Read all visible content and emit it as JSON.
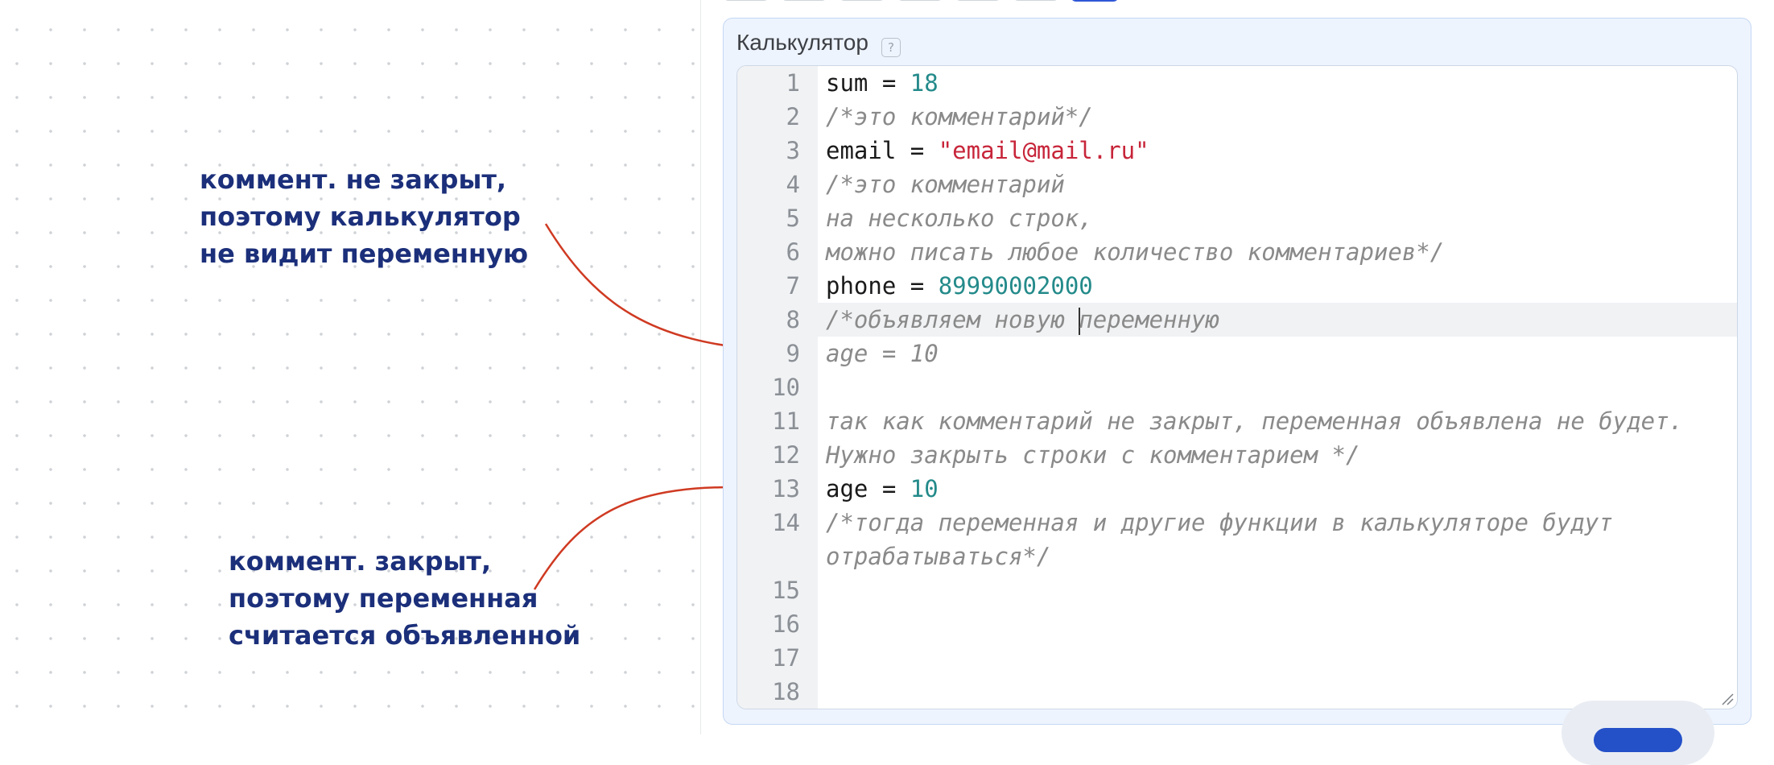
{
  "annotations": {
    "top": "коммент. не закрыт,\nпоэтому калькулятор\nне видит переменную",
    "bottom": "коммент. закрыт,\nпоэтому переменная\nсчитается объявленной"
  },
  "calculator": {
    "title": "Калькулятор",
    "help_icon_text": "?"
  },
  "editor": {
    "line_numbers": [
      "1",
      "2",
      "3",
      "4",
      "5",
      "6",
      "7",
      "8",
      "9",
      "10",
      "11",
      "12",
      "13",
      "14",
      "15",
      "16",
      "17",
      "18"
    ],
    "lines": {
      "l1_var": "sum = ",
      "l1_num": "18",
      "l2": "/*это комментарий*/",
      "l3_var": "email = ",
      "l3_str": "\"email@mail.ru\"",
      "l4": "/*это комментарий",
      "l5": "на несколько строк,",
      "l6": "можно писать любое количество комментариев*/",
      "l7_var": "phone = ",
      "l7_num": "89990002000",
      "l8a": "/*объявляем новую ",
      "l8b": "переменную",
      "l9": "age = 10",
      "l11": "так как комментарий не закрыт, переменная объявлена не будет.",
      "l12": "Нужно закрыть строки с комментарием */",
      "l13_var": "age = ",
      "l13_num": "10",
      "l14a": "/*тогда переменная и другие функции в калькуляторе будут",
      "l14b": "отрабатываться*/"
    }
  },
  "colors": {
    "annotation": "#1b2f7a",
    "arrow": "#cf3a22",
    "comment": "#8a8a8a",
    "number": "#248a8a",
    "string": "#c7253a"
  }
}
